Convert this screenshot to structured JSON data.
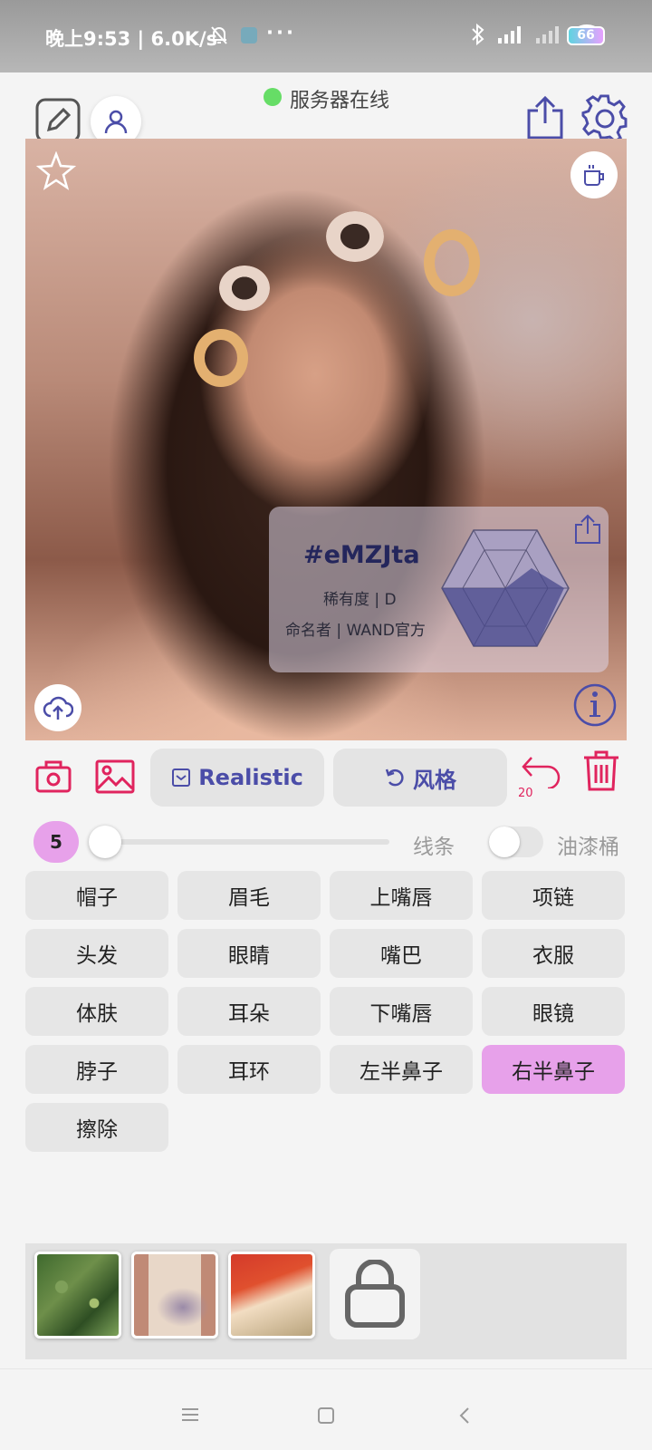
{
  "status_bar": {
    "time_speed": "晚上9:53 | 6.0K/s",
    "more": "···",
    "battery": "66"
  },
  "header": {
    "server_status": "服务器在线",
    "status_color": "#66dd66"
  },
  "card": {
    "tag": "#eMZJta",
    "rarity": "稀有度 | D",
    "namer": "命名者 | WAND官方"
  },
  "toolbar": {
    "realistic_label": "Realistic",
    "style_label": "风格",
    "undo_count": "20"
  },
  "brush": {
    "size": "5",
    "slider_fraction": 0.0,
    "line_label": "线条",
    "bucket_label": "油漆桶",
    "bucket_enabled": false
  },
  "parts": [
    {
      "label": "帽子",
      "selected": false
    },
    {
      "label": "眉毛",
      "selected": false
    },
    {
      "label": "上嘴唇",
      "selected": false
    },
    {
      "label": "项链",
      "selected": false
    },
    {
      "label": "头发",
      "selected": false
    },
    {
      "label": "眼睛",
      "selected": false
    },
    {
      "label": "嘴巴",
      "selected": false
    },
    {
      "label": "衣服",
      "selected": false
    },
    {
      "label": "体肤",
      "selected": false
    },
    {
      "label": "耳朵",
      "selected": false
    },
    {
      "label": "下嘴唇",
      "selected": false
    },
    {
      "label": "眼镜",
      "selected": false
    },
    {
      "label": "脖子",
      "selected": false
    },
    {
      "label": "耳环",
      "selected": false
    },
    {
      "label": "左半鼻子",
      "selected": false
    },
    {
      "label": "右半鼻子",
      "selected": true
    },
    {
      "label": "擦除",
      "selected": false
    }
  ],
  "colors": {
    "accent": "#e0245e",
    "primary": "#4b4da8",
    "selected": "#e7a1ea"
  }
}
